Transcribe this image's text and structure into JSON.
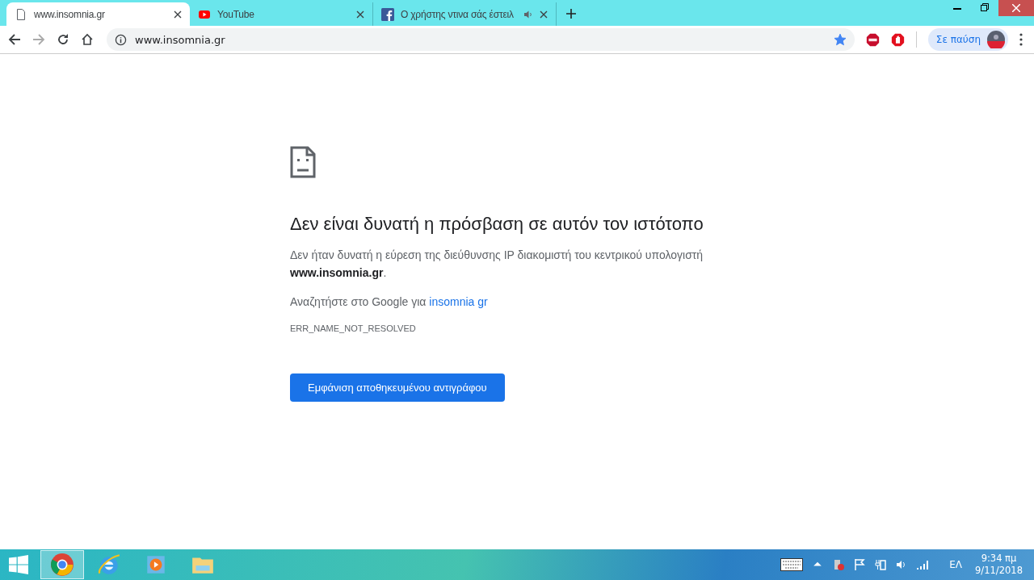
{
  "tabs": [
    {
      "title": "www.insomnia.gr",
      "kind": "page",
      "selected": true,
      "audio": false
    },
    {
      "title": "YouTube",
      "kind": "youtube",
      "selected": false,
      "audio": false
    },
    {
      "title": "Ο χρήστης ντινα σάς έστειλ",
      "kind": "facebook",
      "selected": false,
      "audio": true
    }
  ],
  "toolbar": {
    "address": "www.insomnia.gr",
    "bookmarked": true,
    "profile_label": "Σε παύση"
  },
  "error": {
    "title": "Δεν είναι δυνατή η πρόσβαση σε αυτόν τον ιστότοπο",
    "message": "Δεν ήταν δυνατή η εύρεση της διεύθυνσης IP διακομιστή του κεντρικού υπολογιστή **www.insomnia.gr**.",
    "search_prefix": "Αναζητήστε στο Google για",
    "search_link": "insomnia gr",
    "code": "ERR_NAME_NOT_RESOLVED",
    "button": "Εμφάνιση αποθηκευμένου αντιγράφου"
  },
  "taskbar": {
    "apps": [
      {
        "kind": "chrome",
        "selected": true
      },
      {
        "kind": "ie",
        "selected": false
      },
      {
        "kind": "media",
        "selected": false
      },
      {
        "kind": "explorer",
        "selected": false
      }
    ],
    "language": "ΕΛ",
    "time": "9:34 πμ",
    "date": "9/11/2018"
  }
}
